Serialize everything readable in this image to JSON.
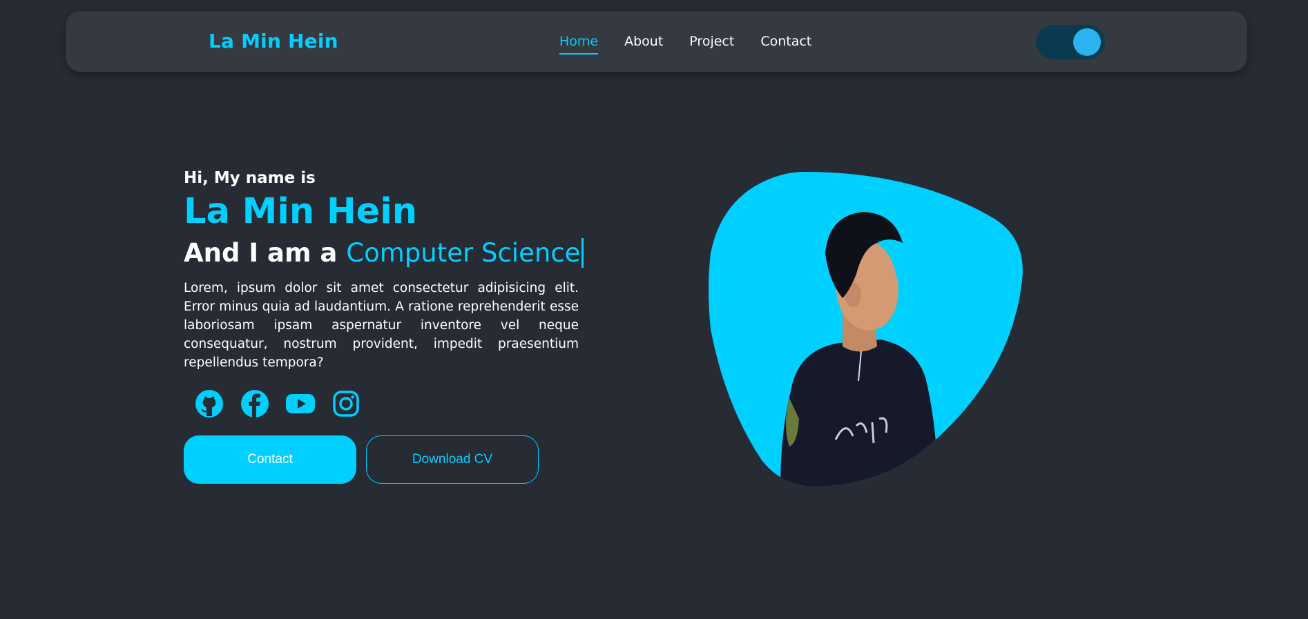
{
  "nav": {
    "brand": "La Min Hein",
    "links": [
      "Home",
      "About",
      "Project",
      "Contact"
    ],
    "active_link": "Home",
    "theme_toggle_on": true
  },
  "hero": {
    "greeting": "Hi, My name is",
    "name": "La Min Hein",
    "role_prefix": "And I am a",
    "role": "Computer Science",
    "description": "Lorem, ipsum dolor sit amet consectetur adipisicing elit. Error minus quia ad laudantium. A ratione reprehenderit esse laboriosam ipsam aspernatur inventore vel neque consequatur, nostrum provident, impedit praesentium repellendus tempora?",
    "social_icons": [
      "github-icon",
      "facebook-icon",
      "youtube-icon",
      "instagram-icon"
    ],
    "contact_button": "Contact",
    "download_button": "Download CV"
  },
  "colors": {
    "background": "#272b33",
    "navbar": "#353940",
    "accent": "#00d0ff",
    "toggle_track": "#0a3a4f",
    "toggle_knob": "#2bb3ef"
  }
}
